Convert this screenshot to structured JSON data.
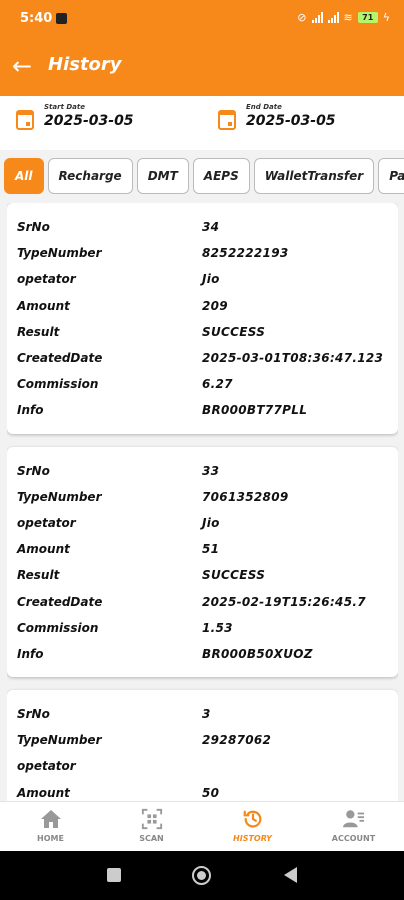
{
  "status_bar": {
    "time": "5:40",
    "battery": "71"
  },
  "app_bar": {
    "back_icon": "arrow-left-icon",
    "title": "History"
  },
  "date_range": {
    "start_label": "Start Date",
    "start_value": "2025-03-05",
    "end_label": "End Date",
    "end_value": "2025-03-05"
  },
  "tabs": [
    "All",
    "Recharge",
    "DMT",
    "AEPS",
    "WalletTransfer",
    "Pan"
  ],
  "field_labels": {
    "srno": "SrNo",
    "type_number": "TypeNumber",
    "operator": "opetator",
    "amount": "Amount",
    "result": "Result",
    "created_date": "CreatedDate",
    "commission": "Commission",
    "info": "Info"
  },
  "records": [
    {
      "srno": "34",
      "type_number": "8252222193",
      "operator": "Jio",
      "amount": "209",
      "result": "SUCCESS",
      "created_date": "2025-03-01T08:36:47.123",
      "commission": "6.27",
      "info": "BR000BT77PLL"
    },
    {
      "srno": "33",
      "type_number": "7061352809",
      "operator": "Jio",
      "amount": "51",
      "result": "SUCCESS",
      "created_date": "2025-02-19T15:26:45.7",
      "commission": "1.53",
      "info": "BR000B50XUOZ"
    },
    {
      "srno": "3",
      "type_number": "29287062",
      "operator": "",
      "amount": "50"
    }
  ],
  "bottom_nav": [
    {
      "label": "HOME",
      "icon": "home-icon"
    },
    {
      "label": "SCAN",
      "icon": "qr-scan-icon"
    },
    {
      "label": "HISTORY",
      "icon": "history-icon"
    },
    {
      "label": "ACCOUNT",
      "icon": "account-icon"
    }
  ],
  "colors": {
    "primary": "#f7891b",
    "background": "#f2f2f2"
  }
}
